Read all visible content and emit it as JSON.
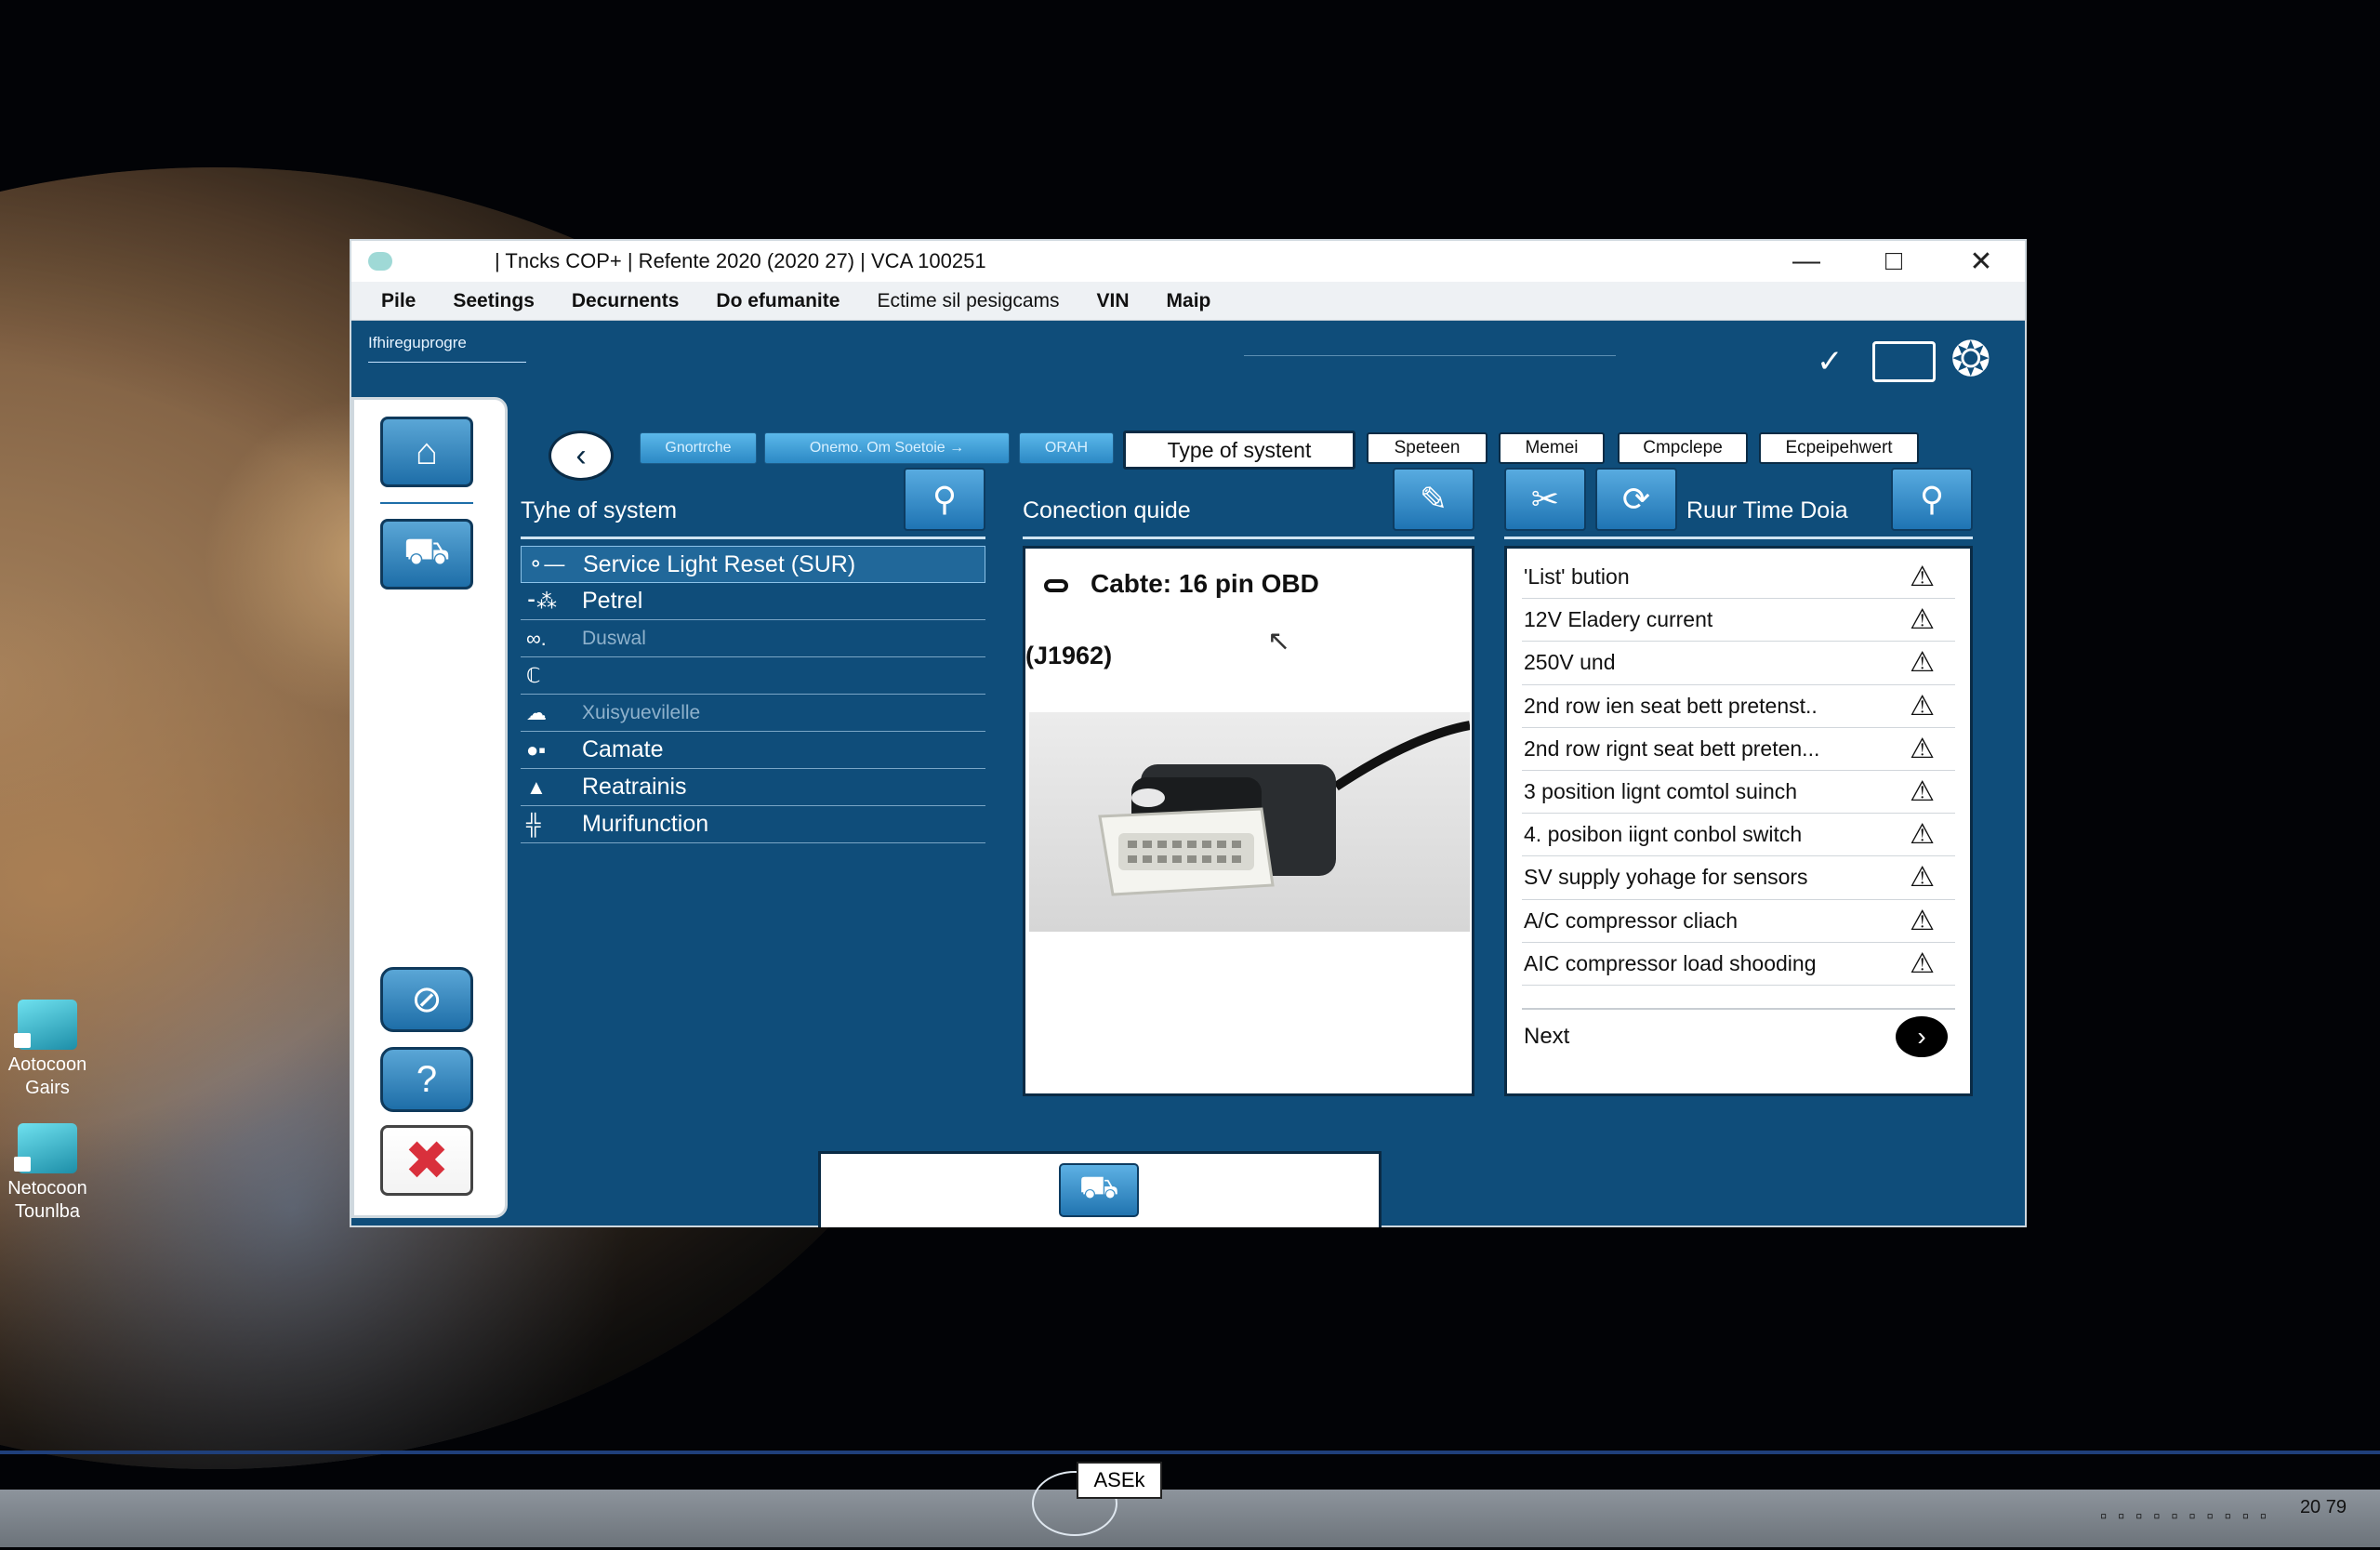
{
  "window": {
    "title": "| Tncks COP+  |  Refente 2020 (2020 27)  |  VCA 100251"
  },
  "menu": [
    "Pile",
    "Seetings",
    "Decurnents",
    "Do efumanite",
    "Ectime sil pesigcams",
    "VIN",
    "Maip"
  ],
  "status_strip": "Ifhireguprogre",
  "tabs": [
    {
      "label": "Gnortrche",
      "style": "blue"
    },
    {
      "label": "Onemo. Om Soetoie →",
      "style": "blue"
    },
    {
      "label": "ORAH",
      "style": "blue"
    },
    {
      "label": "Type of systent",
      "style": "active"
    },
    {
      "label": "Speteen",
      "style": "white"
    },
    {
      "label": "Memei",
      "style": "white"
    },
    {
      "label": "Cmpclepe",
      "style": "white"
    },
    {
      "label": "Ecpeipehwert",
      "style": "white"
    }
  ],
  "system_panel": {
    "title": "Tyhe of system",
    "items": [
      {
        "label": "Service Light Reset (SUR)",
        "state": "selected"
      },
      {
        "label": "Petrel",
        "state": "normal"
      },
      {
        "label": "Duswal",
        "state": "dim"
      },
      {
        "label": "",
        "state": "dim"
      },
      {
        "label": "Xuisyuevilelle",
        "state": "dim"
      },
      {
        "label": "Camate",
        "state": "normal"
      },
      {
        "label": "Reatrainis",
        "state": "normal"
      },
      {
        "label": "Murifunction",
        "state": "normal"
      }
    ]
  },
  "connection_panel": {
    "title": "Conection quide",
    "cable": "Cabte: 16 pin OBD",
    "standard": "(J1962)"
  },
  "runtime_panel": {
    "title": "Ruur Time Doia",
    "items": [
      "'List' bution",
      "12V Eladery current",
      "250V und",
      "2nd row ien seat bett pretenst..",
      "2nd row rignt seat bett preten...",
      "3 position lignt comtol suinch",
      "4. posibon iignt conbol switch",
      "SV supply yohage for sensors",
      "A/C compressor cliach",
      "AIC compressor load shooding"
    ],
    "next_label": "Next"
  },
  "desktop_icons": [
    {
      "label_line1": "Aotocoon",
      "label_line2": "Gairs"
    },
    {
      "label_line1": "Netocoon",
      "label_line2": "Tounlba"
    }
  ],
  "taskbar": {
    "tooltip": "ASEk",
    "clock": "20 79"
  }
}
